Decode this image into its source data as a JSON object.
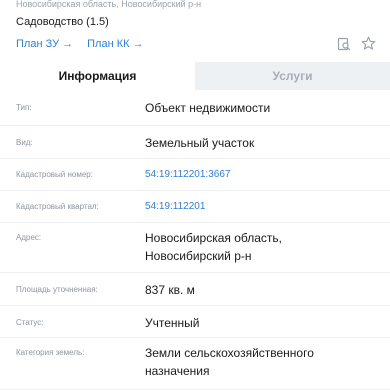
{
  "header": {
    "address_line": "Новосибирская область, Новосибирский р-н",
    "use_type": "Садоводство (1.5)",
    "plan_zu": "План ЗУ →",
    "plan_kk": "План КК →"
  },
  "tabs": [
    {
      "label": "Информация",
      "active": true
    },
    {
      "label": "Услуги",
      "active": false
    }
  ],
  "rows": [
    {
      "label": "Тип:",
      "value": "Объект недвижимости",
      "link": false
    },
    {
      "label": "Вид:",
      "value": "Земельный участок",
      "link": false
    },
    {
      "label": "Кадастровый номер:",
      "value": "54:19:112201:3667",
      "link": true
    },
    {
      "label": "Кадастровый квартал:",
      "value": "54:19:112201",
      "link": true
    },
    {
      "label": "Адрес:",
      "value": "Новосибирская область, Новосибирский р-н",
      "link": false
    },
    {
      "label": "Площадь уточненная:",
      "value": "837 кв. м",
      "link": false
    },
    {
      "label": "Статус:",
      "value": "Учтенный",
      "link": false
    },
    {
      "label": "Категория земель:",
      "value": "Земли сельскохозяйственного назначения",
      "link": false
    }
  ],
  "icons": [
    "search-document-icon",
    "star-icon"
  ]
}
